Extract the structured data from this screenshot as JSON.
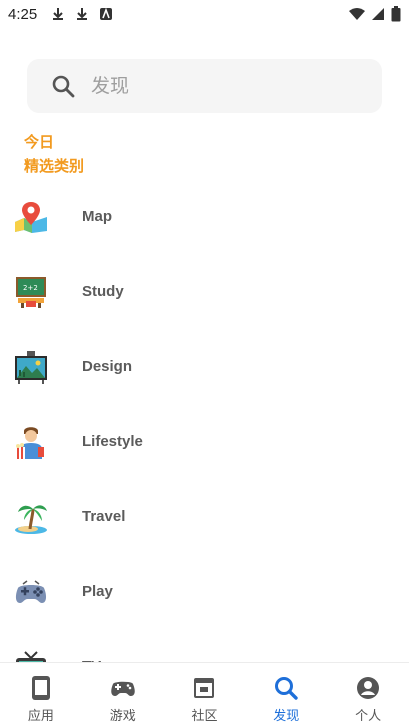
{
  "status_bar": {
    "time": "4:25",
    "left_icons": [
      "download-icon",
      "download-icon",
      "app-notification-icon"
    ],
    "right_icons": [
      "wifi-icon",
      "cell-signal-icon",
      "battery-icon"
    ]
  },
  "search": {
    "placeholder": "发现"
  },
  "sections": {
    "today": "今日",
    "featured": "精选类别"
  },
  "categories": [
    {
      "label": "Map",
      "icon": "map-pin-icon"
    },
    {
      "label": "Study",
      "icon": "chalkboard-icon"
    },
    {
      "label": "Design",
      "icon": "easel-icon"
    },
    {
      "label": "Lifestyle",
      "icon": "person-popcorn-icon"
    },
    {
      "label": "Travel",
      "icon": "palm-tree-icon"
    },
    {
      "label": "Play",
      "icon": "gamepad-icon"
    },
    {
      "label": "TV",
      "icon": "tv-icon"
    }
  ],
  "bottom_nav": {
    "items": [
      {
        "label": "应用",
        "icon": "phone-app-icon",
        "active": false
      },
      {
        "label": "游戏",
        "icon": "gamepad-icon",
        "active": false
      },
      {
        "label": "社区",
        "icon": "community-icon",
        "active": false
      },
      {
        "label": "发现",
        "icon": "search-icon",
        "active": true
      },
      {
        "label": "个人",
        "icon": "user-icon",
        "active": false
      }
    ]
  },
  "colors": {
    "accent": "#f29a1f",
    "active_nav": "#1e6fd9"
  }
}
